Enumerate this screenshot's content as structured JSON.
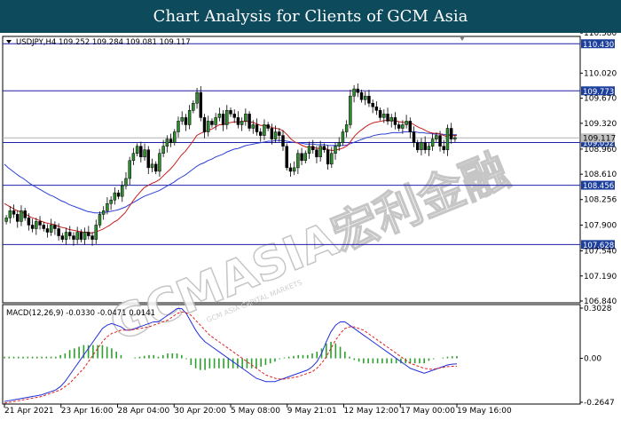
{
  "header": {
    "title": "Chart Analysis for Clients of GCM Asia"
  },
  "chart_data": {
    "type": "candlestick",
    "symbol_line": "USDJPY,H4  109.252 109.284 109.081 109.117",
    "macd_label": "MACD(12,26,9) -0.0330 -0.0471 0.0141",
    "watermark": "GCMASIA宏利金融",
    "watermark_sub": "GCM ASIA CAPITAL MARKETS",
    "price_axis": {
      "ylim": [
        106.84,
        110.52
      ],
      "ticks": [
        "110.580",
        "110.020",
        "109.670",
        "109.320",
        "108.960",
        "108.610",
        "108.256",
        "107.900",
        "107.540",
        "107.190",
        "106.840"
      ]
    },
    "current_price": "109.117",
    "levels": [
      {
        "value": 110.43,
        "label": "110.430"
      },
      {
        "value": 109.773,
        "label": "109.773"
      },
      {
        "value": 109.052,
        "label": "109.052"
      },
      {
        "value": 108.456,
        "label": "108.456"
      },
      {
        "value": 107.628,
        "label": "107.628"
      }
    ],
    "x_labels": [
      "21 Apr 2021",
      "23 Apr 16:00",
      "28 Apr 04:00",
      "30 Apr 20:00",
      "5 May 08:00",
      "9 May 21:01",
      "12 May 12:00",
      "17 May 00:00",
      "19 May 16:00"
    ],
    "close": [
      108.0,
      108.1,
      108.05,
      107.95,
      108.1,
      108.0,
      107.9,
      107.85,
      107.95,
      107.9,
      107.85,
      107.8,
      107.9,
      107.85,
      107.75,
      107.7,
      107.8,
      107.75,
      107.7,
      107.8,
      107.7,
      107.8,
      107.75,
      107.7,
      107.9,
      108.05,
      108.1,
      108.2,
      108.25,
      108.35,
      108.3,
      108.45,
      108.55,
      108.8,
      108.9,
      109.0,
      108.85,
      108.95,
      108.7,
      108.75,
      108.65,
      108.9,
      109.0,
      109.1,
      109.05,
      109.2,
      109.35,
      109.4,
      109.3,
      109.5,
      109.6,
      109.75,
      109.4,
      109.2,
      109.35,
      109.3,
      109.4,
      109.45,
      109.3,
      109.5,
      109.45,
      109.4,
      109.3,
      109.35,
      109.45,
      109.25,
      109.3,
      109.2,
      109.15,
      109.3,
      109.25,
      109.1,
      109.2,
      109.15,
      109.0,
      108.7,
      108.65,
      108.7,
      108.9,
      108.8,
      108.9,
      109.0,
      108.95,
      108.85,
      109.0,
      108.95,
      108.75,
      108.9,
      109.0,
      109.05,
      109.2,
      109.3,
      109.7,
      109.8,
      109.75,
      109.65,
      109.7,
      109.6,
      109.55,
      109.5,
      109.4,
      109.45,
      109.35,
      109.4,
      109.3,
      109.25,
      109.3,
      109.35,
      109.2,
      109.05,
      108.95,
      109.05,
      108.95,
      109.0,
      109.1,
      109.15,
      109.0,
      108.95,
      109.25,
      109.1,
      109.12
    ],
    "ema_red": [
      108.2,
      108.17,
      108.14,
      108.11,
      108.09,
      108.07,
      108.04,
      108.01,
      107.99,
      107.97,
      107.95,
      107.93,
      107.92,
      107.91,
      107.89,
      107.87,
      107.86,
      107.84,
      107.83,
      107.82,
      107.81,
      107.8,
      107.8,
      107.79,
      107.8,
      107.82,
      107.84,
      107.87,
      107.9,
      107.94,
      107.97,
      108.02,
      108.07,
      108.15,
      108.23,
      108.3,
      108.36,
      108.42,
      108.45,
      108.48,
      108.5,
      108.53,
      108.58,
      108.63,
      108.68,
      108.74,
      108.81,
      108.88,
      108.93,
      109.0,
      109.07,
      109.15,
      109.18,
      109.2,
      109.22,
      109.24,
      109.27,
      109.3,
      109.3,
      109.32,
      109.33,
      109.34,
      109.34,
      109.34,
      109.35,
      109.34,
      109.33,
      109.31,
      109.29,
      109.29,
      109.28,
      109.26,
      109.25,
      109.24,
      109.21,
      109.16,
      109.1,
      109.06,
      109.04,
      109.01,
      108.99,
      108.99,
      108.98,
      108.97,
      108.97,
      108.97,
      108.95,
      108.94,
      108.95,
      108.96,
      108.98,
      109.01,
      109.08,
      109.15,
      109.2,
      109.24,
      109.28,
      109.31,
      109.33,
      109.34,
      109.35,
      109.36,
      109.36,
      109.36,
      109.35,
      109.34,
      109.33,
      109.33,
      109.32,
      109.29,
      109.26,
      109.24,
      109.21,
      109.19,
      109.18,
      109.18,
      109.16,
      109.14,
      109.15,
      109.15,
      109.15
    ],
    "ema_blue": [
      108.75,
      108.7,
      108.66,
      108.62,
      108.58,
      108.55,
      108.51,
      108.47,
      108.44,
      108.41,
      108.38,
      108.35,
      108.32,
      108.3,
      108.27,
      108.24,
      108.22,
      108.19,
      108.17,
      108.15,
      108.13,
      108.11,
      108.09,
      108.08,
      108.07,
      108.07,
      108.07,
      108.08,
      108.09,
      108.1,
      108.11,
      108.13,
      108.15,
      108.18,
      108.21,
      108.24,
      108.27,
      108.3,
      108.32,
      108.34,
      108.36,
      108.38,
      108.41,
      108.44,
      108.47,
      108.5,
      108.54,
      108.57,
      108.6,
      108.64,
      108.68,
      108.72,
      108.75,
      108.77,
      108.8,
      108.82,
      108.85,
      108.87,
      108.89,
      108.92,
      108.94,
      108.96,
      108.97,
      108.99,
      109.01,
      109.02,
      109.03,
      109.04,
      109.05,
      109.06,
      109.07,
      109.07,
      109.08,
      109.08,
      109.08,
      109.07,
      109.06,
      109.05,
      109.05,
      109.04,
      109.03,
      109.03,
      109.03,
      109.02,
      109.02,
      109.02,
      109.01,
      109.01,
      109.01,
      109.01,
      109.01,
      109.02,
      109.04,
      109.06,
      109.08,
      109.1,
      109.12,
      109.13,
      109.15,
      109.16,
      109.17,
      109.17,
      109.18,
      109.19,
      109.19,
      109.19,
      109.2,
      109.2,
      109.2,
      109.2,
      109.19,
      109.19,
      109.18,
      109.18,
      109.17,
      109.17,
      109.17,
      109.16,
      109.16,
      109.16,
      109.16
    ],
    "macd_axis": {
      "ylim": [
        -0.2647,
        0.3028
      ],
      "ticks": [
        "0.3028",
        "0.00",
        "-0.2647"
      ]
    },
    "macd_line": [
      -0.26,
      -0.255,
      -0.25,
      -0.245,
      -0.24,
      -0.235,
      -0.23,
      -0.225,
      -0.22,
      -0.21,
      -0.2,
      -0.19,
      -0.17,
      -0.14,
      -0.1,
      -0.06,
      -0.02,
      0.02,
      0.06,
      0.1,
      0.14,
      0.18,
      0.2,
      0.21,
      0.2,
      0.19,
      0.17,
      0.17,
      0.18,
      0.19,
      0.2,
      0.21,
      0.22,
      0.22,
      0.24,
      0.26,
      0.28,
      0.3,
      0.3,
      0.27,
      0.22,
      0.17,
      0.13,
      0.1,
      0.08,
      0.06,
      0.04,
      0.02,
      0.0,
      -0.02,
      -0.04,
      -0.06,
      -0.08,
      -0.1,
      -0.12,
      -0.13,
      -0.14,
      -0.14,
      -0.14,
      -0.13,
      -0.12,
      -0.11,
      -0.1,
      -0.09,
      -0.08,
      -0.07,
      -0.05,
      -0.02,
      0.03,
      0.1,
      0.16,
      0.2,
      0.22,
      0.22,
      0.2,
      0.18,
      0.16,
      0.14,
      0.12,
      0.1,
      0.08,
      0.06,
      0.04,
      0.02,
      0.0,
      -0.02,
      -0.04,
      -0.06,
      -0.07,
      -0.08,
      -0.09,
      -0.08,
      -0.07,
      -0.06,
      -0.05,
      -0.04,
      -0.035,
      -0.033
    ],
    "signal_line": [
      -0.27,
      -0.265,
      -0.26,
      -0.255,
      -0.25,
      -0.245,
      -0.24,
      -0.235,
      -0.23,
      -0.22,
      -0.21,
      -0.2,
      -0.19,
      -0.17,
      -0.15,
      -0.12,
      -0.09,
      -0.06,
      -0.02,
      0.02,
      0.06,
      0.1,
      0.13,
      0.15,
      0.16,
      0.17,
      0.17,
      0.17,
      0.175,
      0.18,
      0.185,
      0.19,
      0.2,
      0.21,
      0.22,
      0.23,
      0.25,
      0.27,
      0.28,
      0.275,
      0.26,
      0.23,
      0.2,
      0.17,
      0.14,
      0.12,
      0.1,
      0.08,
      0.06,
      0.04,
      0.02,
      0.0,
      -0.02,
      -0.04,
      -0.06,
      -0.08,
      -0.1,
      -0.11,
      -0.12,
      -0.125,
      -0.125,
      -0.12,
      -0.115,
      -0.11,
      -0.1,
      -0.09,
      -0.08,
      -0.06,
      -0.03,
      0.01,
      0.06,
      0.11,
      0.15,
      0.18,
      0.19,
      0.19,
      0.18,
      0.17,
      0.15,
      0.13,
      0.11,
      0.09,
      0.07,
      0.05,
      0.03,
      0.01,
      -0.01,
      -0.03,
      -0.04,
      -0.05,
      -0.06,
      -0.065,
      -0.065,
      -0.06,
      -0.055,
      -0.05,
      -0.048,
      -0.047
    ]
  }
}
